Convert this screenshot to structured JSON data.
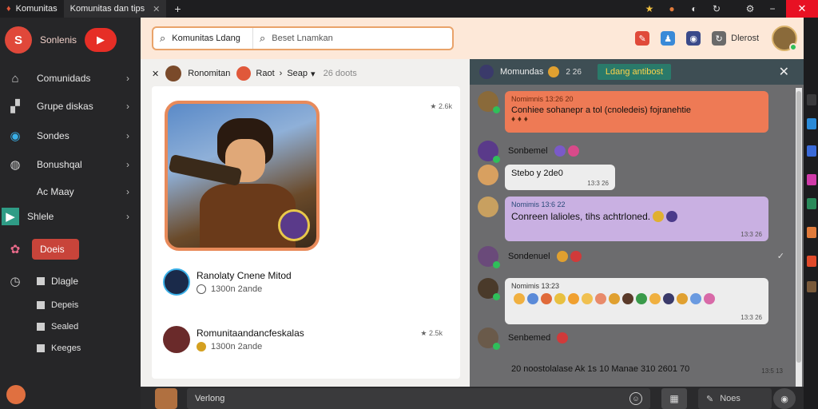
{
  "window": {
    "tabs": [
      {
        "label": "Komunitas",
        "active": false
      },
      {
        "label": "Komunitas dan tips",
        "active": true
      }
    ],
    "new_tab": "+",
    "close": "✕"
  },
  "sidebar": {
    "brand_name": "Sonlenis",
    "items": [
      {
        "label": "Comunidads",
        "icon": "home-icon"
      },
      {
        "label": "Grupe diskas",
        "icon": "chart-icon"
      },
      {
        "label": "Sondes",
        "icon": "globe-icon"
      },
      {
        "label": "Bonushqal",
        "icon": "gamepad-icon"
      },
      {
        "label": "Ac Maay",
        "icon": "none"
      },
      {
        "label": "Shlele",
        "icon": "play-icon"
      },
      {
        "label": "Doeis",
        "icon": "flower-icon",
        "selected": true
      },
      {
        "label": "Dlagle",
        "icon": "clock-icon"
      }
    ],
    "sub_items": [
      "Depeis",
      "Sealed",
      "Keeges"
    ]
  },
  "topbar": {
    "search_scope": "Komunitas Ldang",
    "search_placeholder": "Beset Lnamkan",
    "right_label": "Dlerost"
  },
  "breadcrumb": {
    "community": "Ronomitan",
    "section": "Raot",
    "sub": "Seap",
    "count": "26 doots"
  },
  "feed": {
    "card_meta": "★ 2.6k",
    "posts": [
      {
        "title": "Ranolaty Cnene Mitod",
        "sub": "1300n 2ande",
        "meta": ""
      },
      {
        "title": "Romunitaandancfeskalas",
        "sub": "1300n 2ande",
        "meta": "★ 2.5k"
      }
    ]
  },
  "chat": {
    "title": "Momundas",
    "count": "2 26",
    "pill": "Ldang antibost",
    "messages": [
      {
        "name": "Nomimnis 13:26 20",
        "text": "Conhiee sohanepr a tol (cnoledeis) fojranehtie",
        "emoji_line": "♦ ♦ ♦",
        "time": "",
        "color": "#ee7a55",
        "name_color": "#6a2a10"
      },
      {
        "name": "Sonbemel",
        "text": "",
        "time": "",
        "plain": true
      },
      {
        "name": "",
        "text": "Stebo y 2de0",
        "time": "13:3 26",
        "color": "#ededed"
      },
      {
        "name": "Nomimis 13:6 22",
        "text": "Conreen lalioles, tihs achtrloned.",
        "time": "13:3 26",
        "color": "#c9b0e2",
        "name_color": "#2a4a7a"
      },
      {
        "name": "Sondenuel",
        "text": "",
        "time": "",
        "plain": true
      },
      {
        "name": "Nomimis 13:23",
        "text": "",
        "time": "13:3 26",
        "color": "#ededed",
        "name_color": "#333"
      },
      {
        "name": "Senbemed",
        "text": "",
        "time": "",
        "plain": true
      }
    ],
    "system_line": "20 noostolalase Ak 1s 10 Manae 310 2601 70",
    "system_time": "13:5 13"
  },
  "composer": {
    "placeholder": "Verlong",
    "note_placeholder": "Noes"
  },
  "colors": {
    "accent": "#e0483a",
    "topbar": "#fde8d8",
    "chat_header": "#3e4e54"
  }
}
